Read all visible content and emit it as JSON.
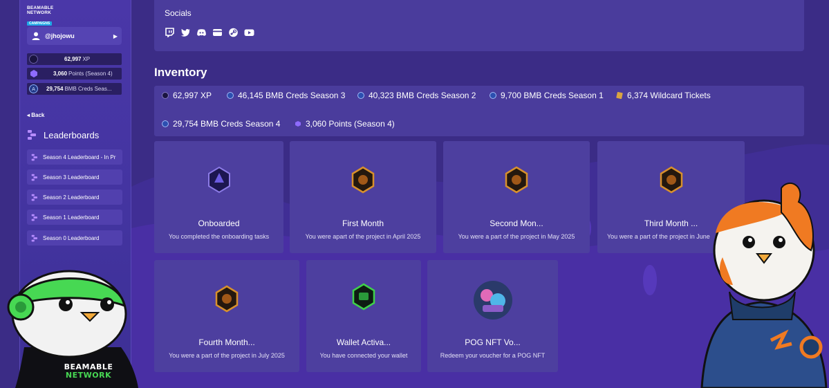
{
  "logo": {
    "line1": "BEAMABLE",
    "line2": "NETWORK",
    "tag": "CAMPAIGNS"
  },
  "user": {
    "handle": "@jhojowu"
  },
  "stats": [
    {
      "value": "62,997",
      "unit": "XP",
      "icon": "xp-icon"
    },
    {
      "value": "3,060",
      "unit": "Points (Season 4)",
      "icon": "points-icon"
    },
    {
      "value": "29,754",
      "unit": "BMB Creds Seas...",
      "icon": "bmb-icon"
    }
  ],
  "nav": {
    "back_label": "Back",
    "leaderboards_label": "Leaderboards",
    "items": [
      "Season 4 Leaderboard - In Pr",
      "Season 3 Leaderboard",
      "Season 2 Leaderboard",
      "Season 1 Leaderboard",
      "Season 0 Leaderboard"
    ]
  },
  "socials": {
    "title": "Socials",
    "icons": [
      "twitch-icon",
      "twitter-icon",
      "discord-icon",
      "wallet-icon",
      "steam-icon",
      "youtube-icon"
    ]
  },
  "inventory": {
    "title": "Inventory",
    "items": [
      "62,997 XP",
      "46,145 BMB Creds Season 3",
      "40,323 BMB Creds Season 2",
      "9,700 BMB Creds Season 1",
      "6,374 Wildcard Tickets",
      "29,754 BMB Creds Season 4",
      "3,060 Points (Season 4)"
    ]
  },
  "achievements": [
    {
      "title": "Onboarded",
      "desc": "You completed the onboarding tasks"
    },
    {
      "title": "First Month",
      "desc": "You were apart of the project in April 2025"
    },
    {
      "title": "Second Mon...",
      "desc": "You were a part of the project in May 2025"
    },
    {
      "title": "Third Month ...",
      "desc": "You were a part of the project in June"
    },
    {
      "title": "Fourth Month...",
      "desc": "You were a part of the project in July 2025"
    },
    {
      "title": "Wallet Activa...",
      "desc": "You have connected your wallet"
    },
    {
      "title": "POG NFT Vo...",
      "desc": "Redeem your voucher for a POG NFT"
    }
  ],
  "mascot_text": {
    "line1": "BEAMABLE",
    "line2": "NETWORK"
  },
  "colors": {
    "background": "#3b2c86",
    "panel": "#4a3c9c",
    "sidebar": "#4a37a8",
    "accent_orange": "#e8771f",
    "accent_green": "#3fd14a"
  }
}
